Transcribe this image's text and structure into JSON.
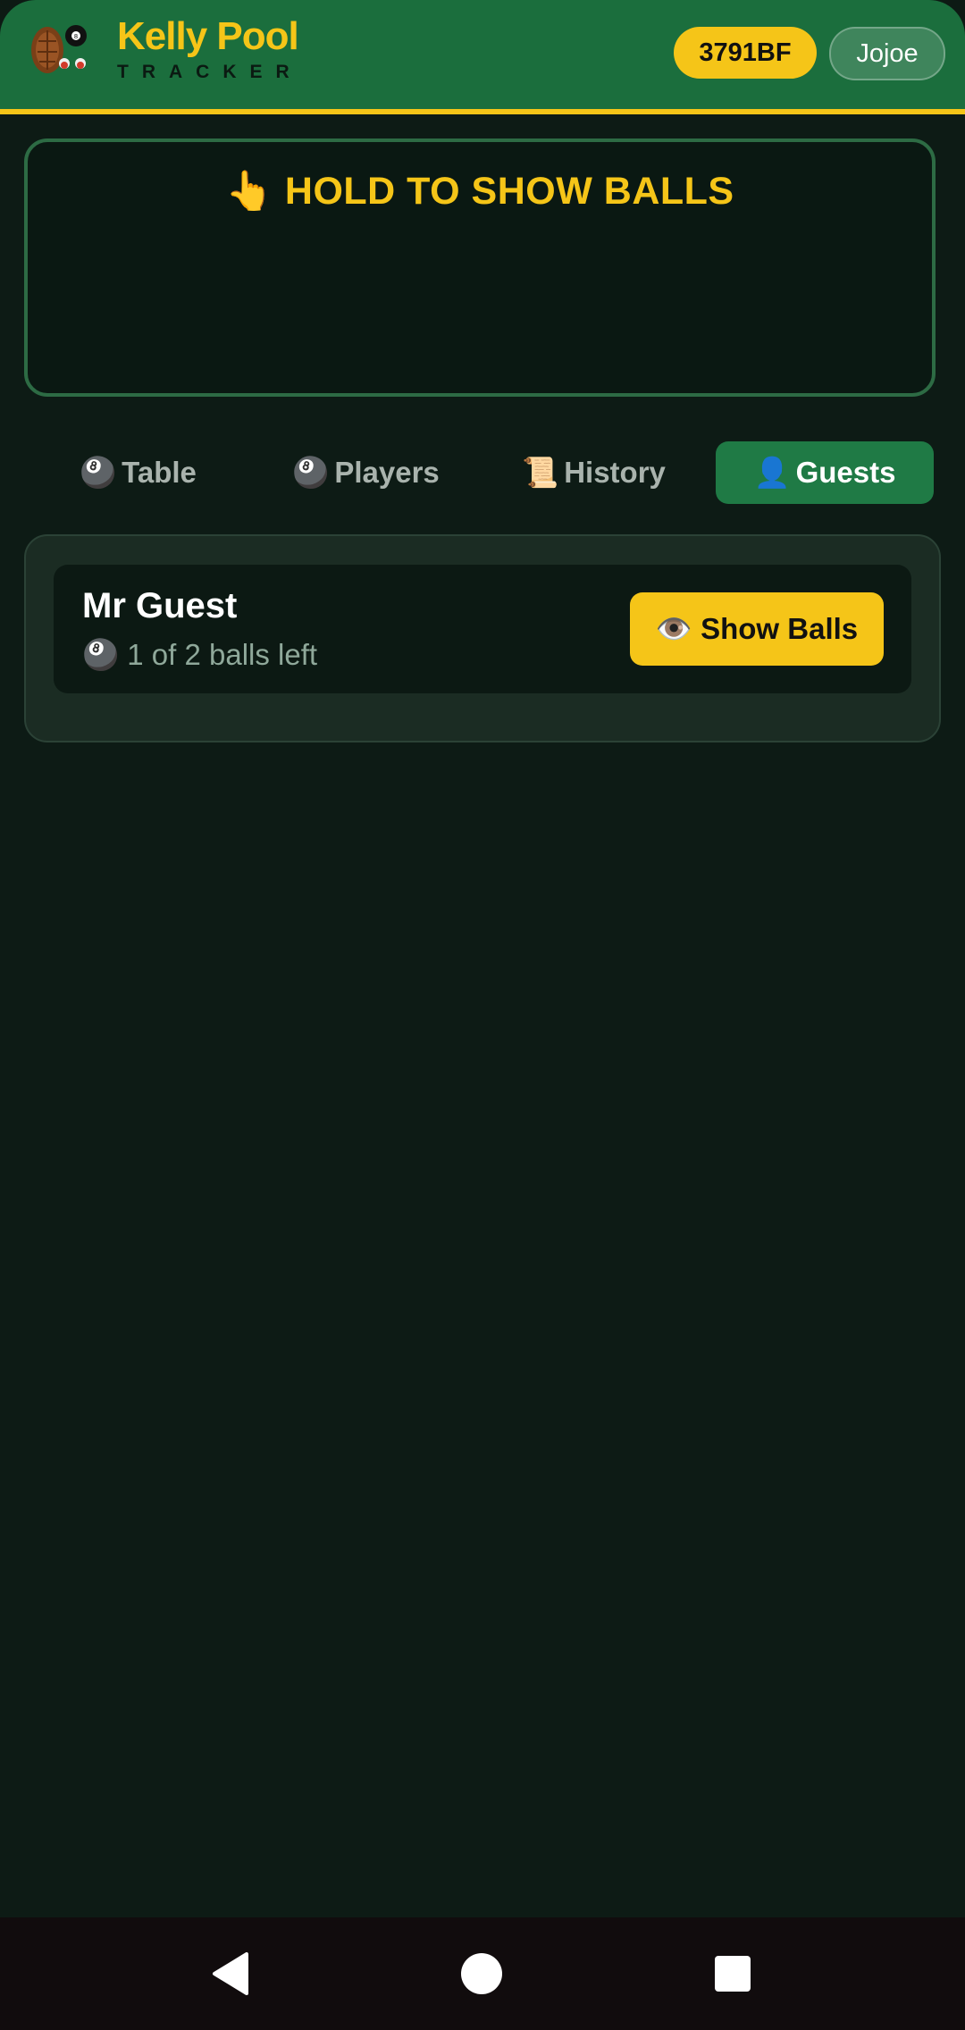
{
  "header": {
    "title": "Kelly Pool",
    "subtitle": "TRACKER",
    "room_code": "3791BF",
    "user": "Jojoe"
  },
  "hold_panel": {
    "icon": "👆",
    "text": "HOLD TO SHOW BALLS"
  },
  "tabs": [
    {
      "icon": "🎱",
      "label": "Table",
      "active": false
    },
    {
      "icon": "🎱",
      "label": "Players",
      "active": false
    },
    {
      "icon": "📜",
      "label": "History",
      "active": false
    },
    {
      "icon": "👤",
      "label": "Guests",
      "active": true
    }
  ],
  "guests": [
    {
      "name": "Mr Guest",
      "ball_icon": "🎱",
      "balls_text": "1 of 2 balls left",
      "button_icon": "👁️",
      "button_label": "Show Balls"
    }
  ],
  "colors": {
    "header_bg": "#1b6e3d",
    "accent": "#f5c518",
    "background": "#0d1b15",
    "active_tab": "#1f7a45"
  },
  "icons": {
    "logo": "turtle-eightball-logo",
    "nav_back": "back-triangle-icon",
    "nav_home": "home-circle-icon",
    "nav_recents": "recents-square-icon"
  }
}
